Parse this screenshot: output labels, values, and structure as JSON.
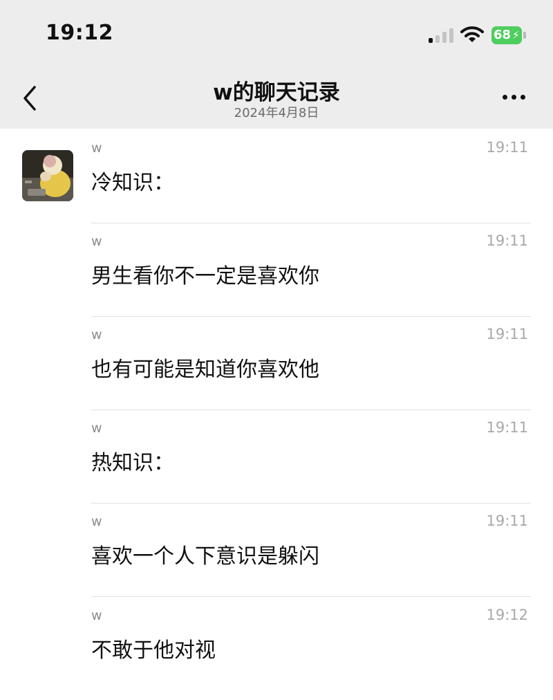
{
  "status_bar": {
    "time": "19:12",
    "battery": "68"
  },
  "nav": {
    "title": "w的聊天记录",
    "date": "2024年4月8日"
  },
  "icons": {
    "back": "chevron-left-icon",
    "more": "more-dots-icon",
    "signal": "cellular-signal-icon",
    "wifi": "wifi-icon",
    "battery": "battery-icon"
  },
  "colors": {
    "header_bg": "#ededed",
    "battery_green": "#4fcd5e",
    "divider": "#e2e2e2"
  },
  "messages": [
    {
      "sender": "w",
      "time": "19:11",
      "text": "冷知识："
    },
    {
      "sender": "w",
      "time": "19:11",
      "text": "男生看你不一定是喜欢你"
    },
    {
      "sender": "w",
      "time": "19:11",
      "text": "也有可能是知道你喜欢他"
    },
    {
      "sender": "w",
      "time": "19:11",
      "text": "热知识："
    },
    {
      "sender": "w",
      "time": "19:11",
      "text": "喜欢一个人下意识是躲闪"
    },
    {
      "sender": "w",
      "time": "19:12",
      "text": "不敢于他对视"
    }
  ]
}
